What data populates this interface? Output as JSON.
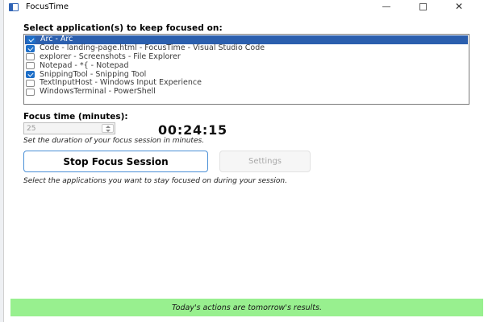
{
  "window": {
    "title": "FocusTime",
    "icon": "app-window-icon",
    "controls": {
      "minimize": "minimize-icon",
      "maximize": "maximize-icon",
      "close": "✕"
    }
  },
  "apps": {
    "label": "Select application(s) to keep focused on:",
    "items": [
      {
        "label": "Arc - Arc",
        "checked": true,
        "highlighted": true
      },
      {
        "label": "Code - landing-page.html - FocusTime - Visual Studio Code",
        "checked": true
      },
      {
        "label": "explorer - Screenshots - File Explorer",
        "checked": false
      },
      {
        "label": "Notepad - *{ - Notepad",
        "checked": false
      },
      {
        "label": "SnippingTool - Snipping Tool",
        "checked": true
      },
      {
        "label": "TextInputHost - Windows Input Experience",
        "checked": false
      },
      {
        "label": "WindowsTerminal - PowerShell",
        "checked": false
      }
    ]
  },
  "focus": {
    "label": "Focus time (minutes):",
    "value": "25",
    "timer": "00:24:15",
    "hint": "Set the duration of your focus session in minutes."
  },
  "actions": {
    "stop_label": "Stop Focus Session",
    "settings_label": "Settings",
    "hint": "Select the applications you want to stay focused on during your session."
  },
  "footer": {
    "text": "Today's actions are tomorrow's results.",
    "color": "#98f08f"
  },
  "colors": {
    "accent": "#1e6fc8",
    "selection": "#2b5fae"
  }
}
